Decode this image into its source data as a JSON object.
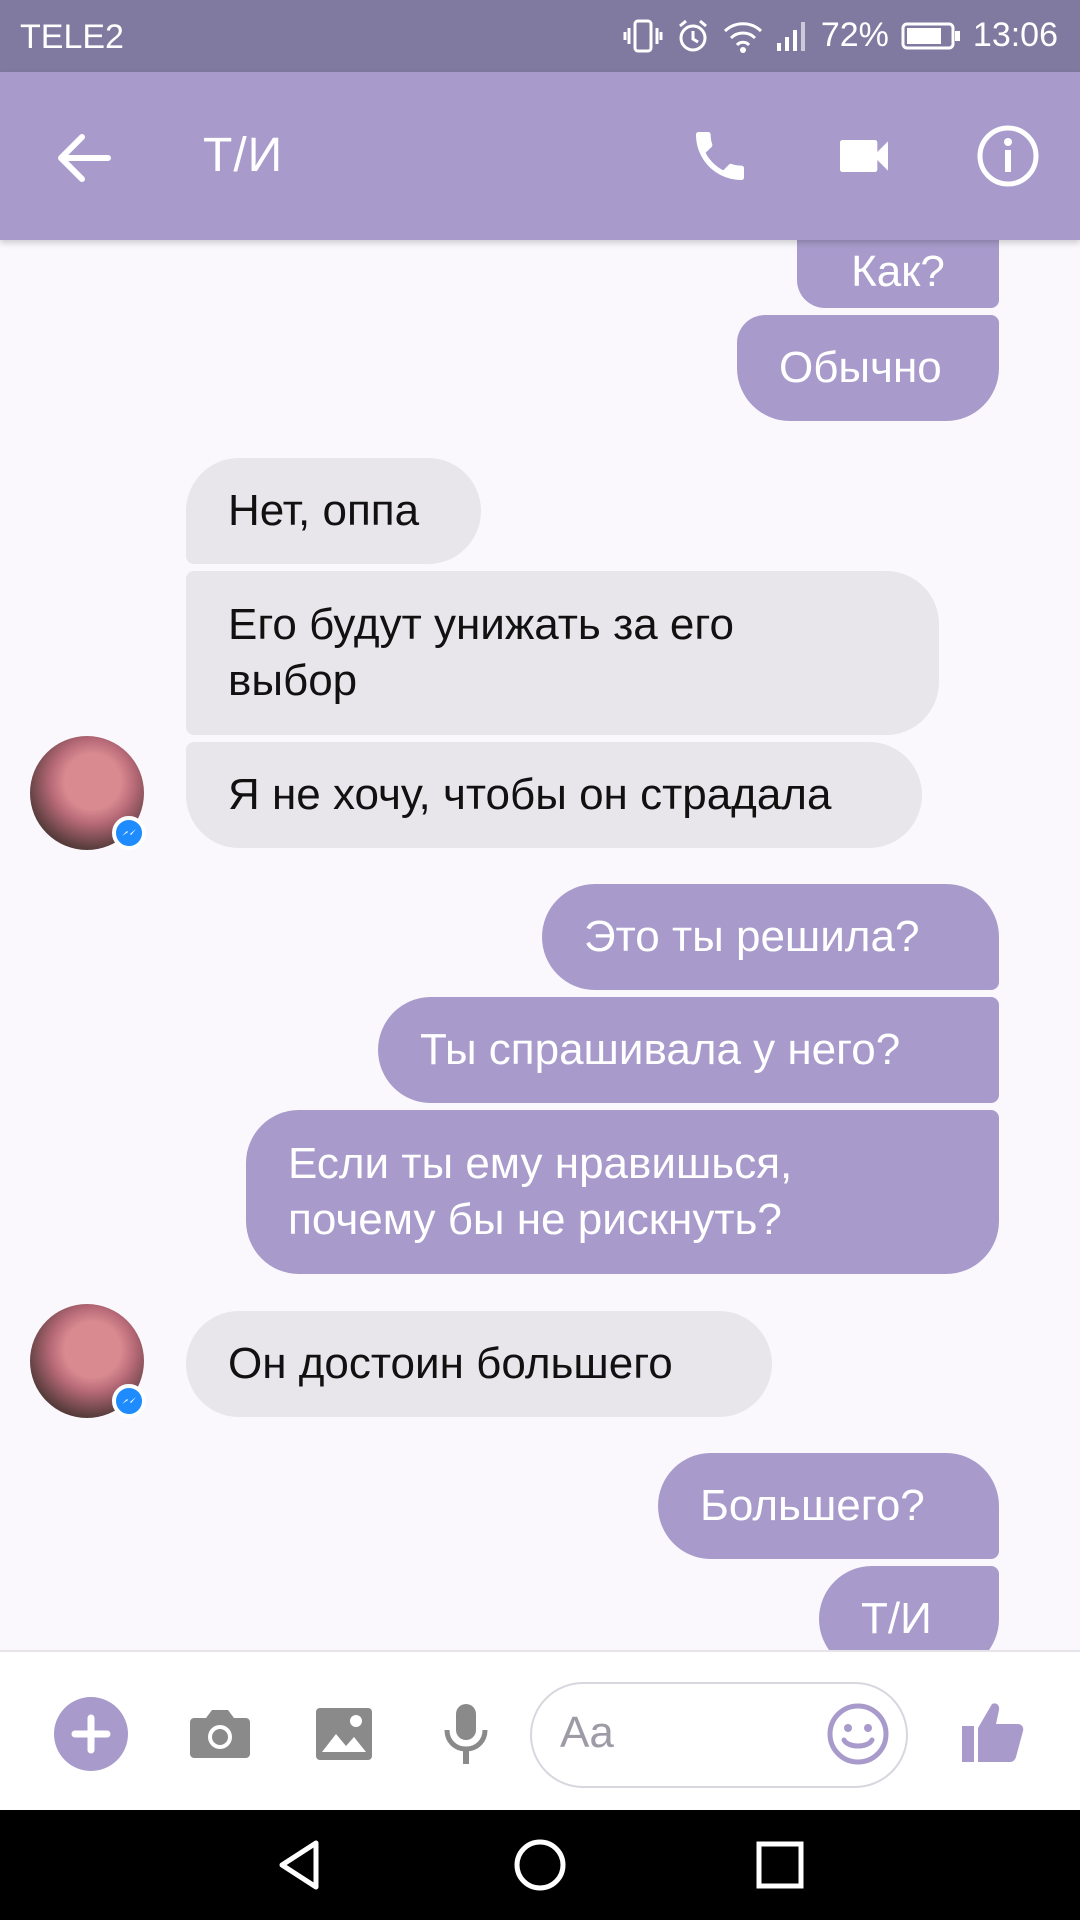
{
  "status_bar": {
    "carrier": "TELE2",
    "battery": "72%",
    "time": "13:06"
  },
  "header": {
    "title": "Т/И",
    "icons": [
      "back-arrow-icon",
      "phone-icon",
      "video-camera-icon",
      "info-icon"
    ]
  },
  "messages": [
    {
      "dir": "out",
      "text": "Как?"
    },
    {
      "dir": "out",
      "text": "Обычно"
    },
    {
      "dir": "in",
      "text": "Нет, оппа"
    },
    {
      "dir": "in",
      "text": "Его будут унижать за его выбор"
    },
    {
      "dir": "in",
      "text": "Я не хочу, чтобы он страдала"
    },
    {
      "dir": "out",
      "text": "Это ты решила?"
    },
    {
      "dir": "out",
      "text": "Ты спрашивала у него?"
    },
    {
      "dir": "out",
      "text": "Если ты ему нравишься, почему бы не рискнуть?"
    },
    {
      "dir": "in",
      "text": "Он достоин большего"
    },
    {
      "dir": "out",
      "text": "Большего?"
    },
    {
      "dir": "out",
      "text": "Т/И"
    }
  ],
  "composer": {
    "placeholder": "Aa",
    "icons": [
      "plus-icon",
      "camera-icon",
      "image-icon",
      "microphone-icon",
      "emoji-icon",
      "thumbs-up-icon"
    ]
  },
  "colors": {
    "accent": "#a89bcc",
    "status_bar": "#8079a0",
    "incoming_bubble": "#e8e6ea",
    "background": "#faf8fc"
  }
}
